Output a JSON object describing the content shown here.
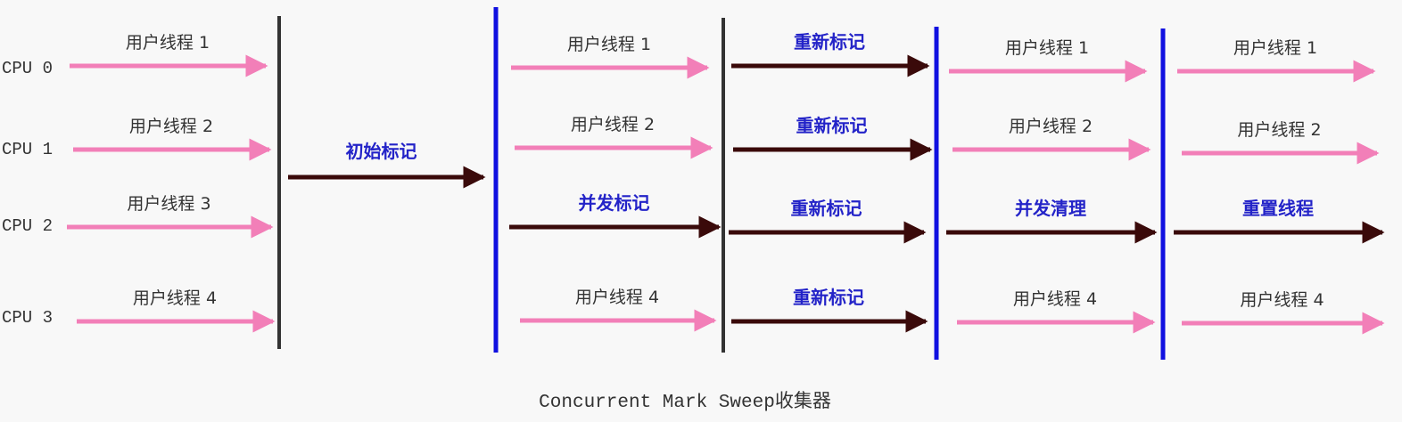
{
  "caption": "Concurrent Mark Sweep收集器",
  "colors": {
    "user_thread": "#f27fb8",
    "gc_thread": "#3a0a0a",
    "phase_black": "#333333",
    "phase_blue": "#1010e0",
    "gc_label": "#2323c8",
    "user_label": "#333333",
    "cpu_label": "#333333",
    "background": "#f8f8f8"
  },
  "cpus": [
    {
      "label": "CPU 0"
    },
    {
      "label": "CPU 1"
    },
    {
      "label": "CPU 2"
    },
    {
      "label": "CPU 3"
    }
  ],
  "phases": [
    {
      "name": "user-1",
      "tracks": [
        {
          "kind": "user",
          "label": "用户线程 1"
        },
        {
          "kind": "user",
          "label": "用户线程 2"
        },
        {
          "kind": "user",
          "label": "用户线程 3"
        },
        {
          "kind": "user",
          "label": "用户线程 4"
        }
      ]
    },
    {
      "name": "initial-mark",
      "span": {
        "kind": "gc",
        "label": "初始标记"
      }
    },
    {
      "name": "concurrent-mark",
      "tracks": [
        {
          "kind": "user",
          "label": "用户线程 1"
        },
        {
          "kind": "user",
          "label": "用户线程 2"
        },
        {
          "kind": "gc",
          "label": "并发标记"
        },
        {
          "kind": "user",
          "label": "用户线程 4"
        }
      ]
    },
    {
      "name": "remark",
      "tracks": [
        {
          "kind": "gc",
          "label": "重新标记"
        },
        {
          "kind": "gc",
          "label": "重新标记"
        },
        {
          "kind": "gc",
          "label": "重新标记"
        },
        {
          "kind": "gc",
          "label": "重新标记"
        }
      ]
    },
    {
      "name": "concurrent-sweep",
      "tracks": [
        {
          "kind": "user",
          "label": "用户线程 1"
        },
        {
          "kind": "user",
          "label": "用户线程 2"
        },
        {
          "kind": "gc",
          "label": "并发清理"
        },
        {
          "kind": "user",
          "label": "用户线程 4"
        }
      ]
    },
    {
      "name": "reset-thread",
      "tracks": [
        {
          "kind": "user",
          "label": "用户线程 1"
        },
        {
          "kind": "user",
          "label": "用户线程 2"
        },
        {
          "kind": "gc",
          "label": "重置线程"
        },
        {
          "kind": "user",
          "label": "用户线程 4"
        }
      ]
    }
  ],
  "dividers": [
    {
      "color": "black"
    },
    {
      "color": "blue"
    },
    {
      "color": "black"
    },
    {
      "color": "blue"
    },
    {
      "color": "blue"
    }
  ]
}
